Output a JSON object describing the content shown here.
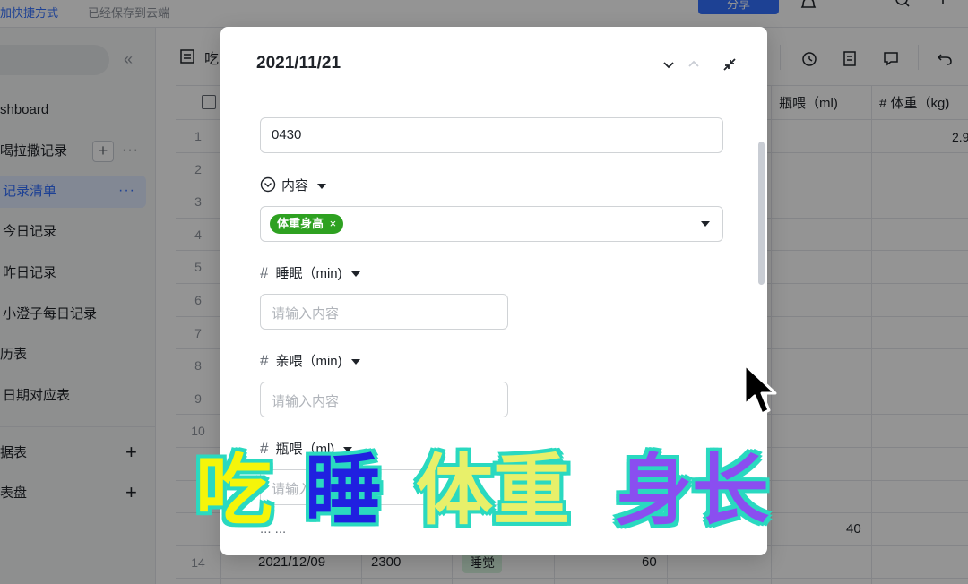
{
  "topbar": {
    "add_shortcut": "加快捷方式",
    "saved_status": "已经保存到云端",
    "share_label": "分享"
  },
  "sidebar": {
    "collapse_icon": "double-chevron-left-icon",
    "items": [
      {
        "label": "shboard"
      },
      {
        "label": "喝拉撒记录"
      },
      {
        "label": "记录清单"
      },
      {
        "label": "今日记录"
      },
      {
        "label": "昨日记录"
      },
      {
        "label": "小澄子每日记录"
      },
      {
        "label": "历表"
      },
      {
        "label": "日期对应表"
      }
    ],
    "sections": [
      {
        "label": "据表"
      },
      {
        "label": "表盘"
      }
    ]
  },
  "main": {
    "title": "吃",
    "columns": [
      {
        "label": "瓶喂（ml)"
      },
      {
        "label": "# 体重（kg)"
      }
    ],
    "row_numbers": [
      "1",
      "2",
      "3",
      "4",
      "5",
      "6",
      "7",
      "8",
      "9",
      "10",
      "",
      "",
      "",
      "14"
    ],
    "cells": {
      "row1_weight": "2.9",
      "row13_bottle": "40",
      "row14_date": "2021/12/09",
      "row14_time": "2300",
      "row14_tag": "睡觉",
      "row14_value": "60"
    }
  },
  "modal": {
    "title": "2021/11/21",
    "time_value": "0430",
    "content_label": "内容",
    "content_tag": "体重身高",
    "fields": [
      {
        "label": "睡眠（min)",
        "placeholder": "请输入内容"
      },
      {
        "label": "亲喂（min)",
        "placeholder": "请输入内容"
      },
      {
        "label": "瓶喂（ml)",
        "placeholder": "请输入"
      }
    ],
    "hidden_label": "...  ..."
  },
  "caption": {
    "part1": "吃",
    "part2": "睡",
    "part3": "体重",
    "part4": "身长"
  },
  "colors": {
    "accent": "#3370ff",
    "tag_green": "#2ea121",
    "caption_outline": "#2ad9c0",
    "caption_yellow": "#f5f50a",
    "caption_blue": "#2020e0",
    "caption_purple": "#8a4ef0"
  }
}
